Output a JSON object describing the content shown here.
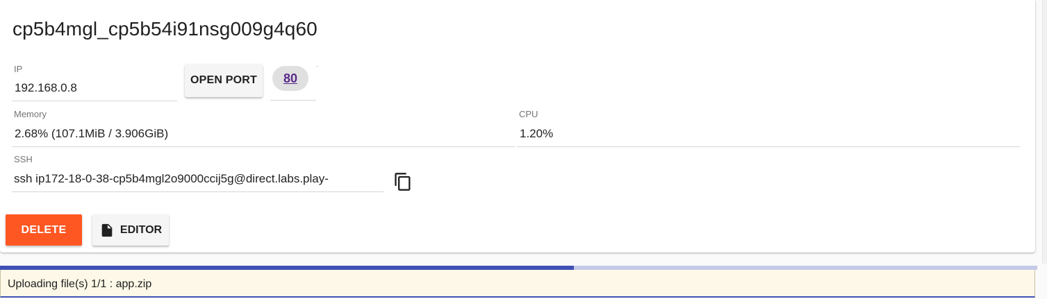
{
  "instance": {
    "title": "cp5b4mgl_cp5b54i91nsg009g4q60"
  },
  "ip": {
    "label": "IP",
    "value": "192.168.0.8"
  },
  "open_port": {
    "label": "OPEN PORT"
  },
  "ports": [
    {
      "label": "80"
    }
  ],
  "memory": {
    "label": "Memory",
    "value": "2.68% (107.1MiB / 3.906GiB)"
  },
  "cpu": {
    "label": "CPU",
    "value": "1.20%"
  },
  "ssh": {
    "label": "SSH",
    "value": "ssh ip172-18-0-38-cp5b4mgl2o9000ccij5g@direct.labs.play-"
  },
  "icons": {
    "copy": "copy-icon",
    "editor": "file-icon"
  },
  "actions": {
    "delete_label": "DELETE",
    "editor_label": "EDITOR"
  },
  "upload": {
    "status_text": "Uploading file(s) 1/1 : app.zip",
    "progress_fraction": 0.553
  },
  "colors": {
    "delete": "#ff5722",
    "progress": "#3f51b5",
    "progress_track": "#c5cae9",
    "link": "#5a2a8a",
    "upload_bg": "#fdf8e7"
  }
}
